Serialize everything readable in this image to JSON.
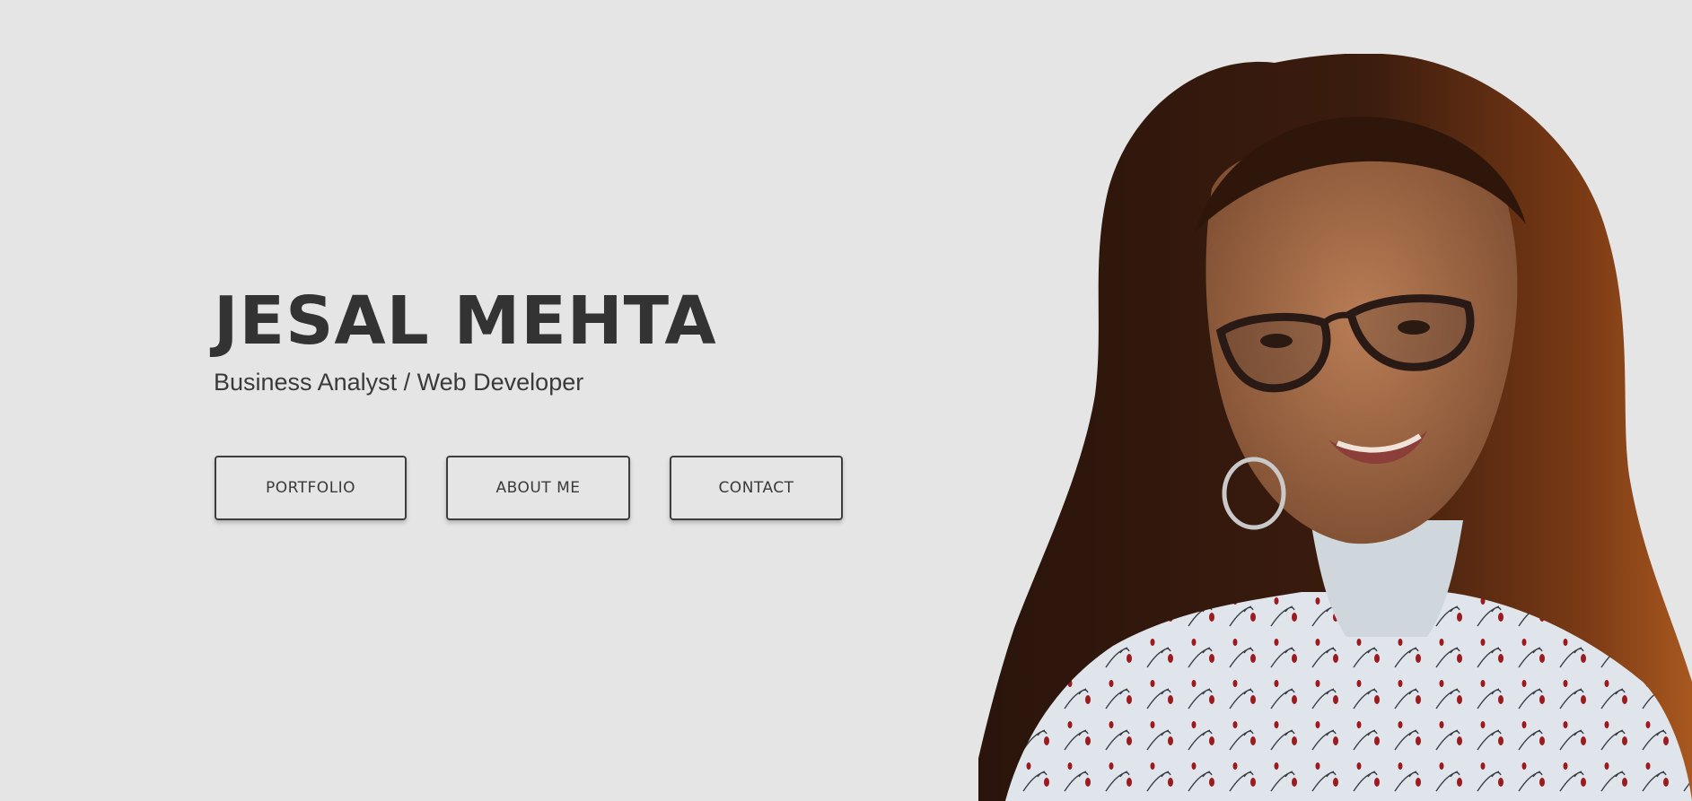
{
  "hero": {
    "name": "JESAL MEHTA",
    "tagline": "Business Analyst / Web Developer"
  },
  "buttons": {
    "portfolio": "PORTFOLIO",
    "about": "ABOUT ME",
    "contact": "CONTACT"
  },
  "colors": {
    "background": "#e5e5e5",
    "text": "#333333",
    "button_border": "#3d3d3d"
  }
}
